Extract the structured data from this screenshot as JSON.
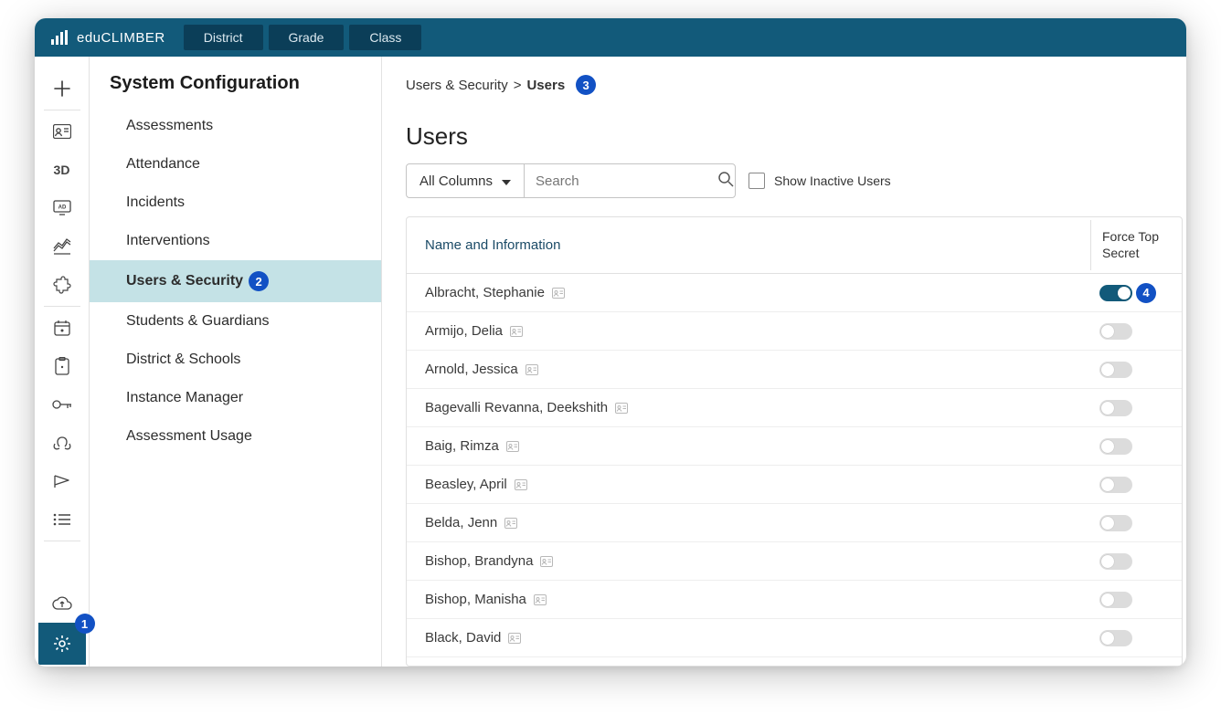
{
  "brand": {
    "name": "eduCLIMBER"
  },
  "top_nav": [
    "District",
    "Grade",
    "Class"
  ],
  "rail": {
    "items": [
      "plus",
      "id-card",
      "3d-text",
      "ad-monitor",
      "analytics",
      "puzzle",
      "calendar",
      "clipboard",
      "key",
      "hands",
      "flag",
      "list"
    ],
    "bottom": [
      "cloud",
      "gear"
    ],
    "settings_badge": "1"
  },
  "sidebar": {
    "title": "System Configuration",
    "items": [
      {
        "label": "Assessments",
        "active": false
      },
      {
        "label": "Attendance",
        "active": false
      },
      {
        "label": "Incidents",
        "active": false
      },
      {
        "label": "Interventions",
        "active": false
      },
      {
        "label": "Users & Security",
        "active": true,
        "badge": "2"
      },
      {
        "label": "Students & Guardians",
        "active": false
      },
      {
        "label": "District & Schools",
        "active": false
      },
      {
        "label": "Instance Manager",
        "active": false
      },
      {
        "label": "Assessment Usage",
        "active": false
      }
    ]
  },
  "breadcrumb": {
    "root": "Users & Security",
    "sep": ">",
    "current": "Users",
    "badge": "3"
  },
  "page": {
    "title": "Users",
    "filter_label": "All Columns",
    "search_placeholder": "Search",
    "show_inactive_label": "Show Inactive Users"
  },
  "table": {
    "header_name": "Name and Information",
    "header_force": "Force Top Secret",
    "rows": [
      {
        "name": "Albracht, Stephanie",
        "on": true,
        "badge": "4"
      },
      {
        "name": "Armijo, Delia",
        "on": false
      },
      {
        "name": "Arnold, Jessica",
        "on": false
      },
      {
        "name": "Bagevalli Revanna, Deekshith",
        "on": false
      },
      {
        "name": "Baig, Rimza",
        "on": false
      },
      {
        "name": "Beasley, April",
        "on": false
      },
      {
        "name": "Belda, Jenn",
        "on": false
      },
      {
        "name": "Bishop, Brandyna",
        "on": false
      },
      {
        "name": "Bishop, Manisha",
        "on": false
      },
      {
        "name": "Black, David",
        "on": false
      }
    ]
  }
}
